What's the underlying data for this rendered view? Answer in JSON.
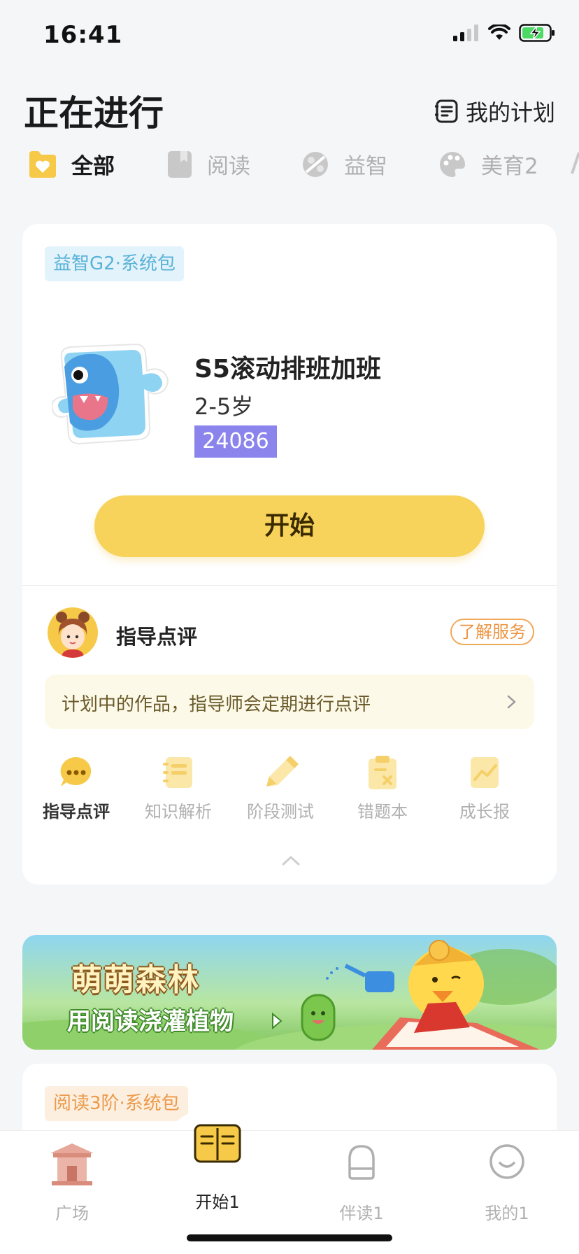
{
  "status_bar": {
    "time": "16:41"
  },
  "header": {
    "title": "正在进行",
    "my_plan": "我的计划"
  },
  "tabs": [
    {
      "label": "全部",
      "icon": "heart-folder-icon",
      "active": true
    },
    {
      "label": "阅读",
      "icon": "book-icon",
      "active": false
    },
    {
      "label": "益智",
      "icon": "puzzle-ball-icon",
      "active": false
    },
    {
      "label": "美育2",
      "icon": "palette-icon",
      "active": false
    }
  ],
  "card1": {
    "tag": "益智G2·系统包",
    "course_title": "S5滚动排班加班",
    "age": "2-5岁",
    "id_badge": "24086",
    "start_button": "开始",
    "guide_title": "指导点评",
    "learn_service": "了解服务",
    "notice": "计划中的作品，指导师会定期进行点评",
    "tools": [
      {
        "label": "指导点评",
        "icon": "chat-bubble-icon",
        "active": true
      },
      {
        "label": "知识解析",
        "icon": "notebook-icon",
        "active": false
      },
      {
        "label": "阶段测试",
        "icon": "pencil-icon",
        "active": false
      },
      {
        "label": "错题本",
        "icon": "clipboard-x-icon",
        "active": false
      },
      {
        "label": "成长报",
        "icon": "growth-chart-icon",
        "active": false
      }
    ]
  },
  "banner": {
    "title": "萌萌森林",
    "subtitle": "用阅读浇灌植物"
  },
  "card2": {
    "tag": "阅读3阶·系统包"
  },
  "bottom_nav": [
    {
      "label": "广场",
      "icon": "pavilion-icon",
      "active": false
    },
    {
      "label": "开始1",
      "icon": "open-book-icon",
      "active": true
    },
    {
      "label": "伴读1",
      "icon": "backpack-icon",
      "active": false
    },
    {
      "label": "我的1",
      "icon": "smile-face-icon",
      "active": false
    }
  ],
  "colors": {
    "accent_yellow": "#f7d35b",
    "id_purple": "#8a84ec",
    "orange": "#ec9340"
  }
}
